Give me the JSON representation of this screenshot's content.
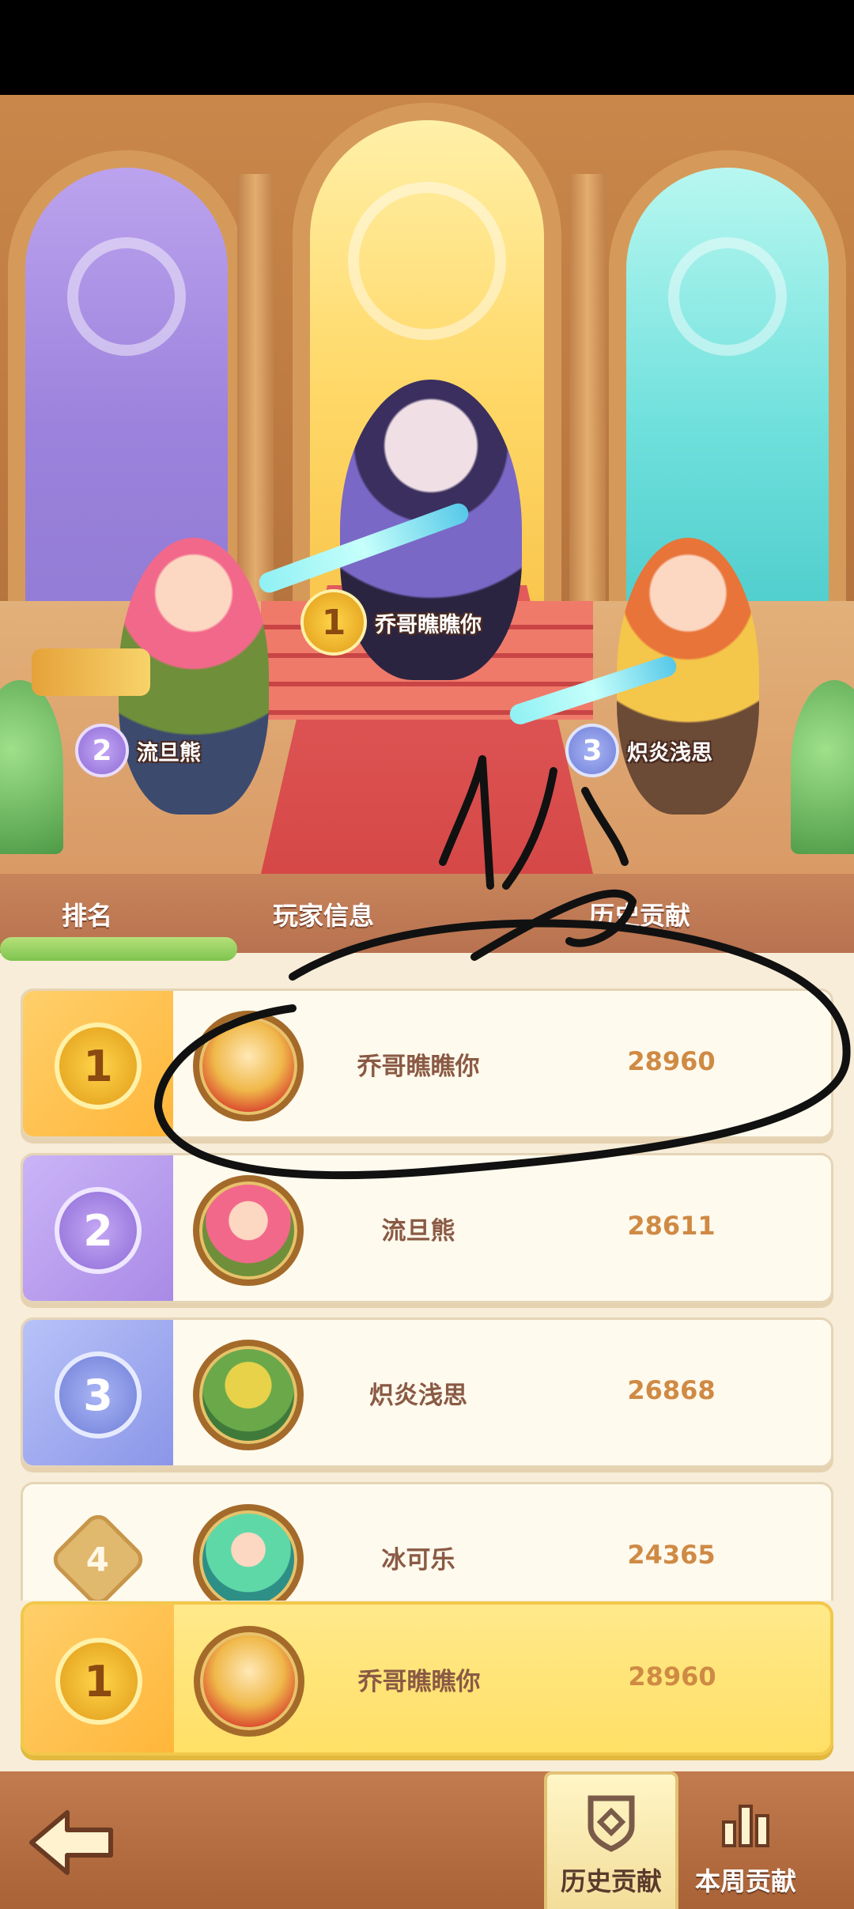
{
  "podium": [
    {
      "rank": "1",
      "name": "乔哥瞧瞧你"
    },
    {
      "rank": "2",
      "name": "流旦熊"
    },
    {
      "rank": "3",
      "name": "炽炎浅思"
    }
  ],
  "header": {
    "col_rank": "排名",
    "col_player": "玩家信息",
    "col_score": "历史贡献"
  },
  "rows": [
    {
      "rank": "1",
      "name": "乔哥瞧瞧你",
      "score": "28960"
    },
    {
      "rank": "2",
      "name": "流旦熊",
      "score": "28611"
    },
    {
      "rank": "3",
      "name": "炽炎浅思",
      "score": "26868"
    },
    {
      "rank": "4",
      "name": "冰可乐",
      "score": "24365"
    }
  ],
  "me": {
    "rank": "1",
    "name": "乔哥瞧瞧你",
    "score": "28960"
  },
  "tabs": {
    "history": "历史贡献",
    "weekly": "本周贡献"
  },
  "colors": {
    "gold": "#f3b62e",
    "silver_purple": "#a98ae6",
    "bronze_blue": "#8a96e8",
    "score": "#cf8a44",
    "name": "#8a5a44"
  },
  "icons": {
    "back": "back-arrow-icon",
    "history_tab": "shield-icon",
    "weekly_tab": "bar-chart-icon"
  }
}
